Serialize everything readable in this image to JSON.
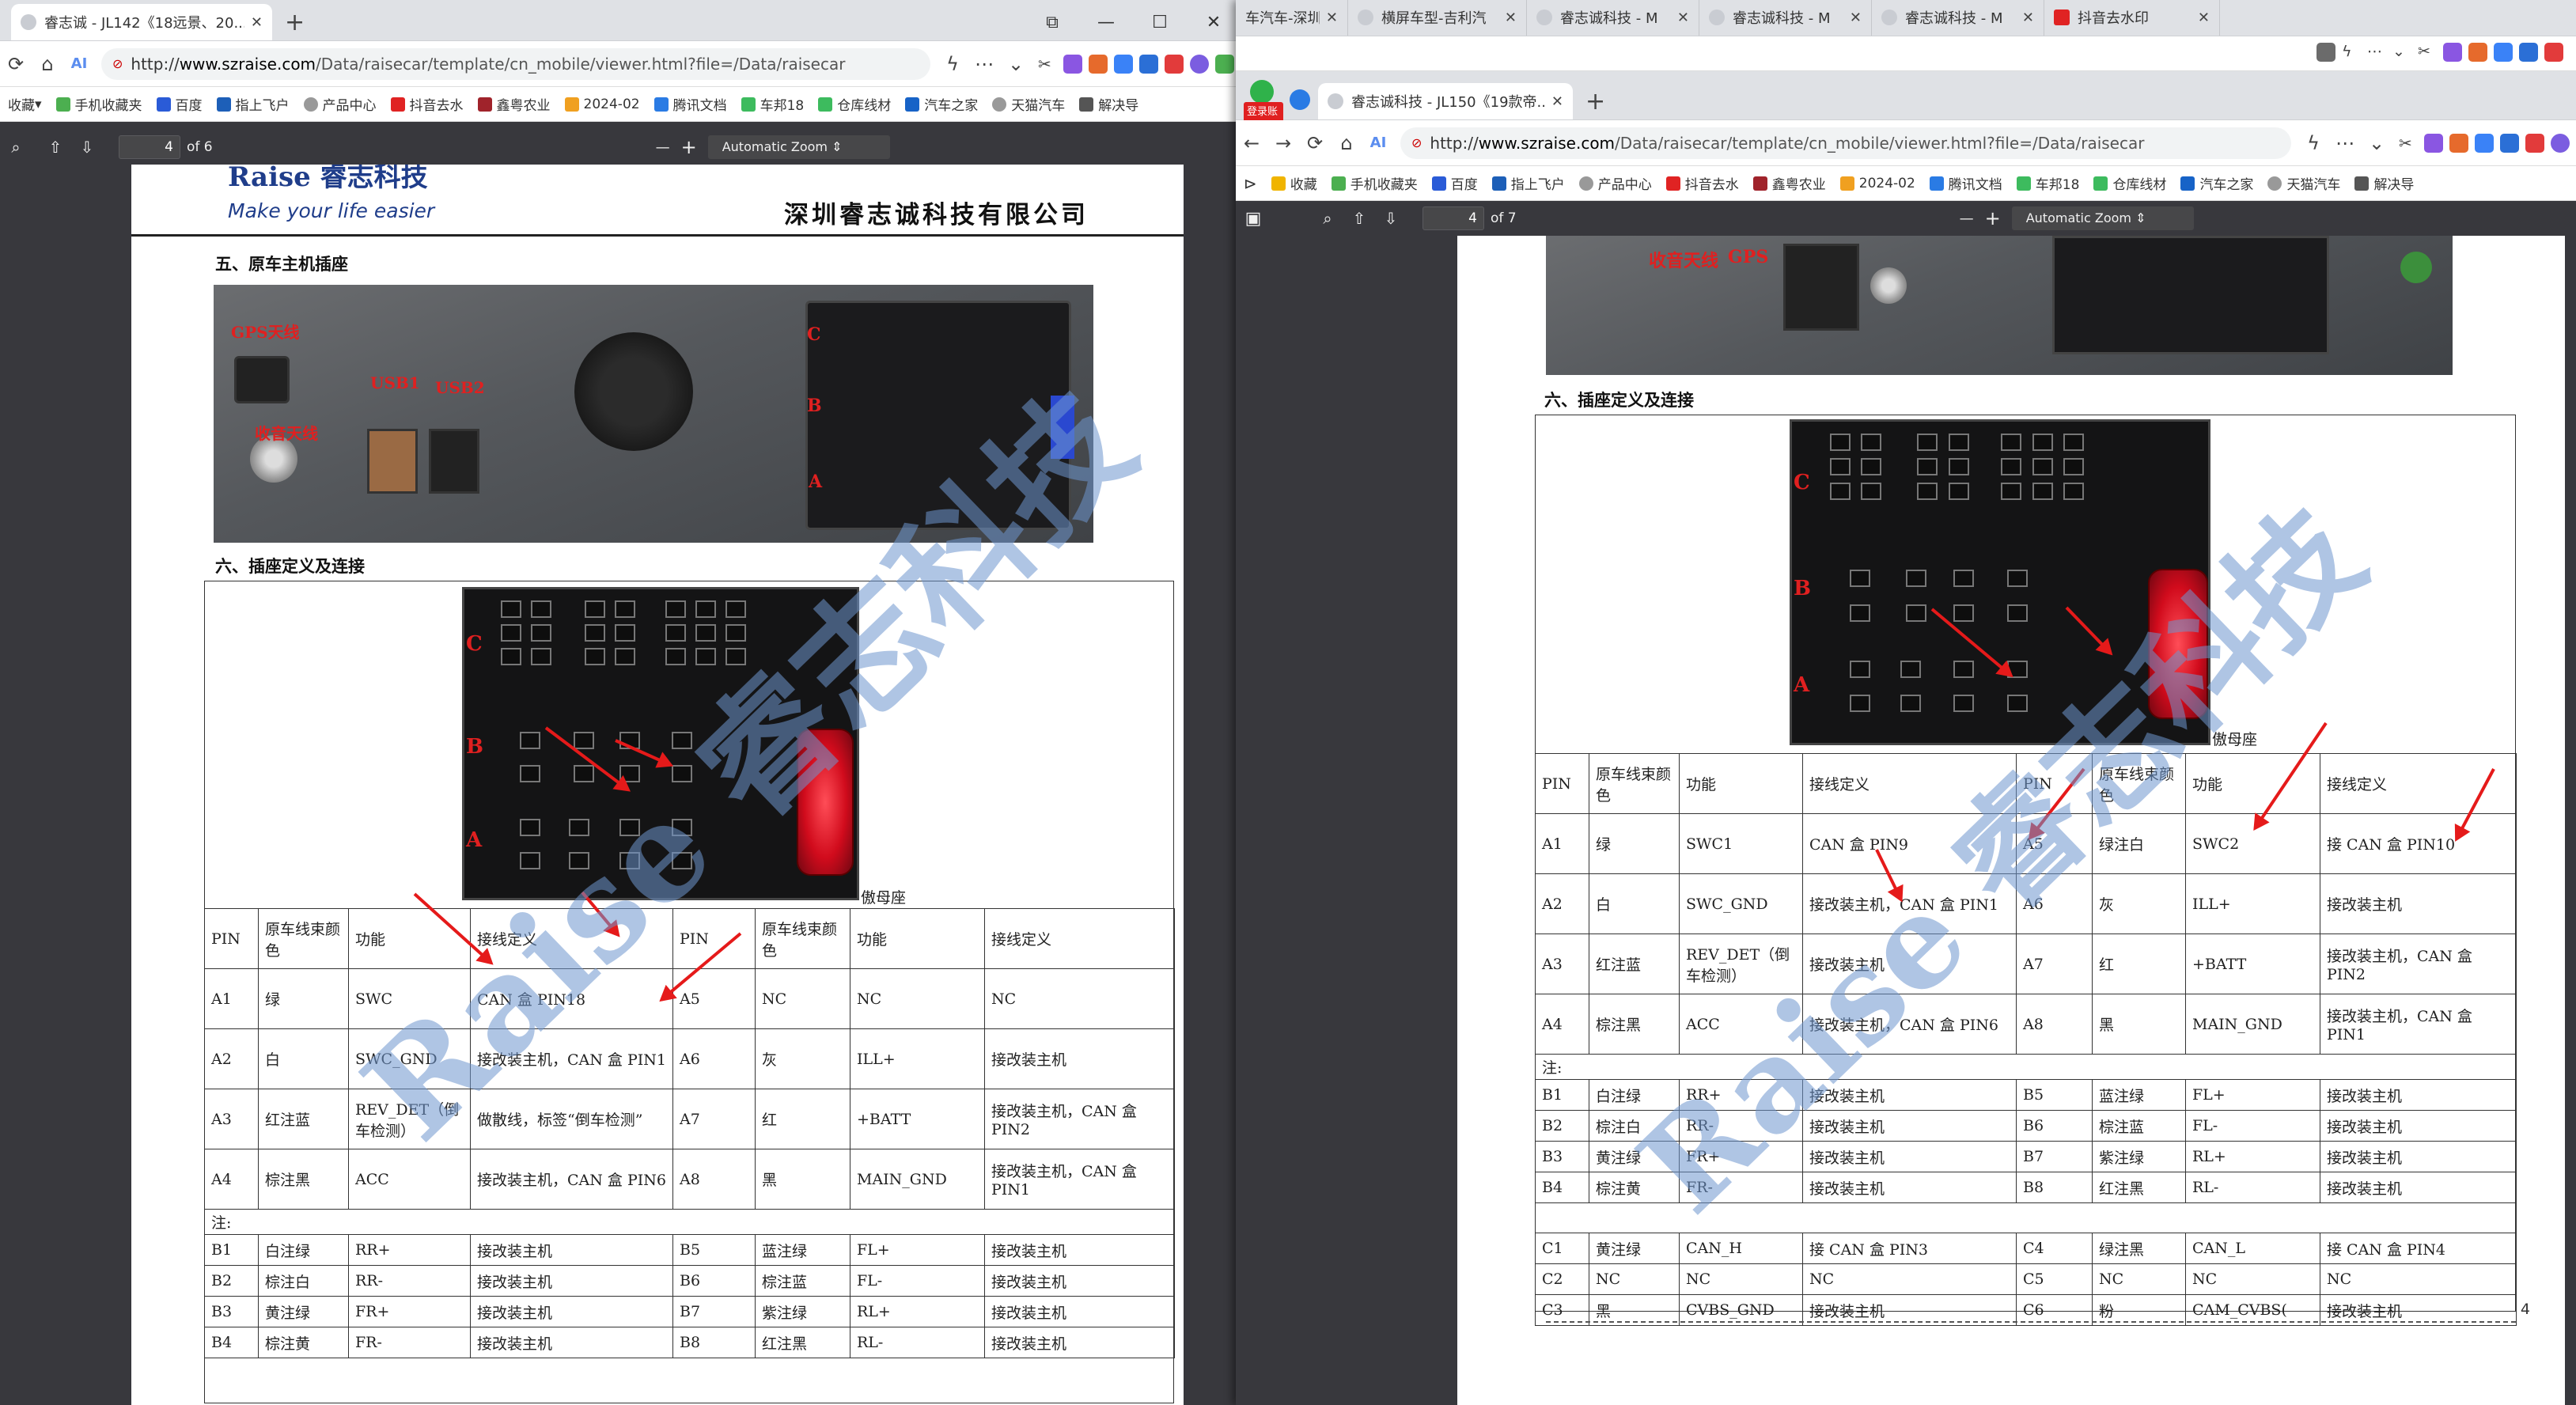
{
  "left": {
    "tabs": [
      {
        "title": "睿志诚 - JL142《18远景、20..."
      }
    ],
    "new_tab": "+",
    "window_controls": {
      "tab_icon": "⧉",
      "min": "—",
      "max": "☐",
      "close": "✕"
    },
    "url_prefix": "http://",
    "url_host": "www.szraise.com",
    "url_path": "/Data/raisecar/template/cn_mobile/viewer.html?file=/Data/raisecar",
    "bookmarks": [
      "收藏",
      "手机收藏夹",
      "百度",
      "指上飞户",
      "产品中心",
      "抖音去水",
      "鑫粤农业",
      "2024-02",
      "腾讯文档",
      "车邦18",
      "仓库线材",
      "汽车之家",
      "天猫汽车",
      "解决导"
    ],
    "pdf": {
      "page": "4",
      "of": "of 6",
      "zoom": "Automatic Zoom"
    },
    "doc": {
      "logo": "Raise 睿志科技",
      "slogan": "Make your life easier",
      "company": "深圳睿志诚科技有限公司",
      "sec5": "五、原车主机插座",
      "sec6": "六、插座定义及连接",
      "photo_labels": [
        "GPS天线",
        "USB1",
        "USB2",
        "收音天线",
        "C",
        "B",
        "A"
      ],
      "conn_rows": [
        "C",
        "B",
        "A"
      ],
      "caption": "傲母座",
      "table": {
        "head": [
          "PIN",
          "原车线束颜色",
          "功能",
          "接线定义",
          "PIN",
          "原车线束颜色",
          "功能",
          "接线定义"
        ],
        "rows": [
          [
            "A1",
            "绿",
            "SWC",
            "CAN 盒 PIN18",
            "A5",
            "NC",
            "NC",
            "NC"
          ],
          [
            "A2",
            "白",
            "SWC_GND",
            "接改装主机，CAN 盒 PIN1",
            "A6",
            "灰",
            "ILL+",
            "接改装主机"
          ],
          [
            "A3",
            "红注蓝",
            "REV_DET（倒车检测）",
            "做散线，标签“倒车检测”",
            "A7",
            "红",
            "+BATT",
            "接改装主机，CAN 盒 PIN2"
          ],
          [
            "A4",
            "棕注黑",
            "ACC",
            "接改装主机，CAN 盒 PIN6",
            "A8",
            "黑",
            "MAIN_GND",
            "接改装主机，CAN 盒 PIN1"
          ]
        ],
        "note": "注:",
        "brows": [
          [
            "B1",
            "白注绿",
            "RR+",
            "接改装主机",
            "B5",
            "蓝注绿",
            "FL+",
            "接改装主机"
          ],
          [
            "B2",
            "棕注白",
            "RR-",
            "接改装主机",
            "B6",
            "棕注蓝",
            "FL-",
            "接改装主机"
          ],
          [
            "B3",
            "黄注绿",
            "FR+",
            "接改装主机",
            "B7",
            "紫注绿",
            "RL+",
            "接改装主机"
          ],
          [
            "B4",
            "棕注黄",
            "FR-",
            "接改装主机",
            "B8",
            "红注黑",
            "RL-",
            "接改装主机"
          ]
        ]
      }
    }
  },
  "right": {
    "tabs_top": [
      "车汽车-深圳睿",
      "横屏车型-吉利汽",
      "睿志诚科技 - M",
      "睿志诚科技 - M",
      "睿志诚科技 - M",
      "抖音去水印"
    ],
    "tabs": [
      {
        "title": "睿志诚科技 - JL150《19款帝..."
      }
    ],
    "new_tab": "+",
    "login_badge": "登录账号",
    "url_prefix": "http://",
    "url_host": "www.szraise.com",
    "url_path": "/Data/raisecar/template/cn_mobile/viewer.html?file=/Data/raisecar",
    "bookmarks": [
      "收藏",
      "手机收藏夹",
      "百度",
      "指上飞户",
      "产品中心",
      "抖音去水",
      "鑫粤农业",
      "2024-02",
      "腾讯文档",
      "车邦18",
      "仓库线材",
      "汽车之家",
      "天猫汽车",
      "解决导"
    ],
    "pdf": {
      "page": "4",
      "of": "of 7",
      "zoom": "Automatic Zoom"
    },
    "doc": {
      "photo_labels": [
        "收音天线",
        "GPS"
      ],
      "sec6": "六、插座定义及连接",
      "conn_rows": [
        "C",
        "B",
        "A"
      ],
      "caption": "傲母座",
      "table": {
        "head": [
          "PIN",
          "原车线束颜色",
          "功能",
          "接线定义",
          "PIN",
          "原车线束颜色",
          "功能",
          "接线定义"
        ],
        "rows": [
          [
            "A1",
            "绿",
            "SWC1",
            "CAN 盒 PIN9",
            "A5",
            "绿注白",
            "SWC2",
            "接 CAN 盒 PIN10"
          ],
          [
            "A2",
            "白",
            "SWC_GND",
            "接改装主机，CAN 盒 PIN1",
            "A6",
            "灰",
            "ILL+",
            "接改装主机"
          ],
          [
            "A3",
            "红注蓝",
            "REV_DET（倒车检测）",
            "接改装主机",
            "A7",
            "红",
            "+BATT",
            "接改装主机，CAN 盒 PIN2"
          ],
          [
            "A4",
            "棕注黑",
            "ACC",
            "接改装主机，CAN 盒 PIN6",
            "A8",
            "黑",
            "MAIN_GND",
            "接改装主机，CAN 盒 PIN1"
          ]
        ],
        "note": "注:",
        "brows": [
          [
            "B1",
            "白注绿",
            "RR+",
            "接改装主机",
            "B5",
            "蓝注绿",
            "FL+",
            "接改装主机"
          ],
          [
            "B2",
            "棕注白",
            "RR-",
            "接改装主机",
            "B6",
            "棕注蓝",
            "FL-",
            "接改装主机"
          ],
          [
            "B3",
            "黄注绿",
            "FR+",
            "接改装主机",
            "B7",
            "紫注绿",
            "RL+",
            "接改装主机"
          ],
          [
            "B4",
            "棕注黄",
            "FR-",
            "接改装主机",
            "B8",
            "红注黑",
            "RL-",
            "接改装主机"
          ]
        ],
        "crows": [
          [
            "C1",
            "黄注绿",
            "CAN_H",
            "接 CAN 盒 PIN3",
            "C4",
            "绿注黑",
            "CAN_L",
            "接 CAN 盒 PIN4"
          ],
          [
            "C2",
            "NC",
            "NC",
            "NC",
            "C5",
            "NC",
            "NC",
            "NC"
          ],
          [
            "C3",
            "黑",
            "CVBS_GND",
            "接改装主机",
            "C6",
            "粉",
            "CAM_CVBS(",
            "接改装主机"
          ]
        ]
      },
      "page_num": "4"
    }
  },
  "watermark": "Raise 睿志科技",
  "colors": {
    "accent_red": "#e51a1a",
    "brand_blue": "#1f3d8a",
    "watermark": "#6e96cd"
  }
}
